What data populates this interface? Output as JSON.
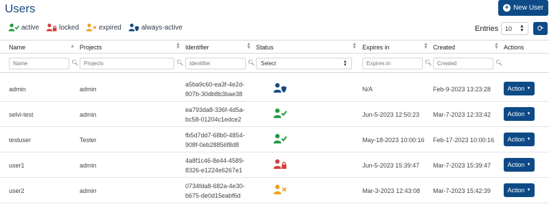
{
  "title": "Users",
  "new_user_label": "New User",
  "legend": [
    {
      "label": "active",
      "icon": "user-check-icon",
      "color": "#1e9b3e"
    },
    {
      "label": "locked",
      "icon": "user-lock-icon",
      "color": "#d63c3c"
    },
    {
      "label": "expired",
      "icon": "user-times-icon",
      "color": "#f0a020"
    },
    {
      "label": "always-active",
      "icon": "user-shield-icon",
      "color": "#17497f"
    }
  ],
  "entries": {
    "label": "Entries",
    "value": "10"
  },
  "columns": [
    "Name",
    "Projects",
    "Identifier",
    "Status",
    "Expires in",
    "Created",
    "Actions"
  ],
  "filters": {
    "name": "Name",
    "projects": "Projects",
    "identifier": "Identifier",
    "status": "Select",
    "expires": "Expires in",
    "created": "Created"
  },
  "rows": [
    {
      "name": "admin",
      "project": "admin",
      "id1": "a5ba9c60-ea3f-4e2d-",
      "id2": "807b-30db8b3bae38",
      "status": "always-active",
      "expires": "N/A",
      "created": "Feb-9-2023 13:23:28",
      "action": "Action"
    },
    {
      "name": "selvi-test",
      "project": "admin",
      "id1": "ea793da8-336f-4d5a-",
      "id2": "bc58-01204c1edce2",
      "status": "active",
      "expires": "Jun-5-2023 12:50:23",
      "created": "Mar-7-2023 12:33:42",
      "action": "Action"
    },
    {
      "name": "testuser",
      "project": "Tester",
      "id1": "fb5d7dd7-68b0-4854-",
      "id2": "908f-0eb28856f8d8",
      "status": "active",
      "expires": "May-18-2023 10:00:16",
      "created": "Feb-17-2023 10:00:16",
      "action": "Action"
    },
    {
      "name": "user1",
      "project": "admin",
      "id1": "4a8f1c46-8e44-4589-",
      "id2": "8326-e1224e6267e1",
      "status": "locked",
      "expires": "Jun-5-2023 15:39:47",
      "created": "Mar-7-2023 15:39:47",
      "action": "Action"
    },
    {
      "name": "user2",
      "project": "admin",
      "id1": "0734fda8-682a-4e30-",
      "id2": "b675-de0d15eabf6d",
      "status": "expired",
      "expires": "Mar-3-2023 12:43:08",
      "created": "Mar-7-2023 15:42:39",
      "action": "Action"
    }
  ]
}
